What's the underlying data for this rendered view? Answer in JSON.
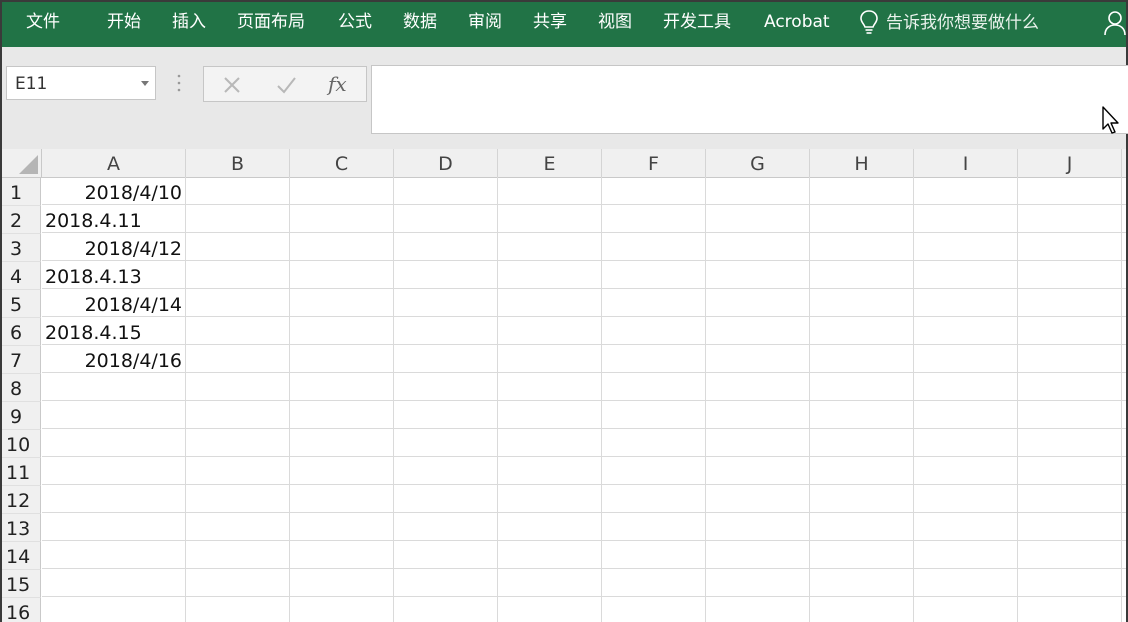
{
  "ribbon": {
    "tabs": [
      "文件",
      "开始",
      "插入",
      "页面布局",
      "公式",
      "数据",
      "审阅",
      "共享",
      "视图",
      "开发工具",
      "Acrobat"
    ],
    "tell_me": "告诉我你想要做什么",
    "icons": {
      "tell_me": "lightbulb-icon",
      "user": "user-icon"
    },
    "color": "#217346"
  },
  "formula_bar": {
    "name_box": "E11",
    "cancel_icon": "close-icon",
    "enter_icon": "check-icon",
    "fx_label": "fx",
    "formula_value": ""
  },
  "sheet": {
    "columns": [
      "A",
      "B",
      "C",
      "D",
      "E",
      "F",
      "G",
      "H",
      "I",
      "J"
    ],
    "rows": [
      "1",
      "2",
      "3",
      "4",
      "5",
      "6",
      "7",
      "8",
      "9",
      "10",
      "11",
      "12",
      "13",
      "14",
      "15",
      "16"
    ],
    "cells_A": [
      {
        "value": "2018/4/10",
        "align": "right"
      },
      {
        "value": "2018.4.11",
        "align": "left"
      },
      {
        "value": "2018/4/12",
        "align": "right"
      },
      {
        "value": "2018.4.13",
        "align": "left"
      },
      {
        "value": "2018/4/14",
        "align": "right"
      },
      {
        "value": "2018.4.15",
        "align": "left"
      },
      {
        "value": "2018/4/16",
        "align": "right"
      }
    ]
  }
}
